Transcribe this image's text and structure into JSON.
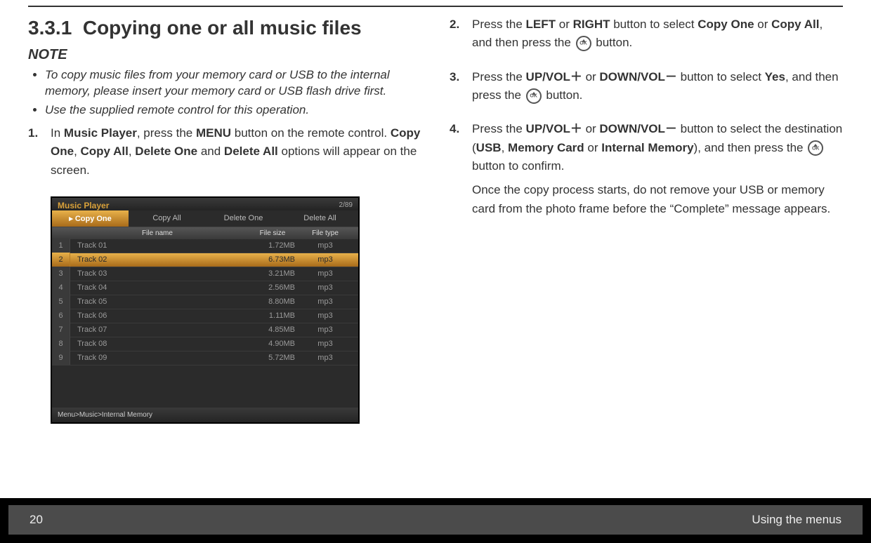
{
  "section": {
    "number": "3.3.1",
    "title": "Copying one or all music files"
  },
  "note": {
    "heading": "NOTE",
    "bullets": [
      "To copy music files from your memory card or USB to the internal memory, please insert your memory card or USB flash drive first.",
      "Use the supplied remote control for this operation."
    ]
  },
  "steps_left": {
    "s1": {
      "num": "1.",
      "pre": "In ",
      "b1": "Music Player",
      "mid1": ", press the ",
      "b2": "MENU",
      "mid2": " button on the remote control. ",
      "b3": "Copy One",
      "sep1": ", ",
      "b4": "Copy All",
      "sep2": ", ",
      "b5": "Delete One",
      "sep3": " and ",
      "b6": "Delete All",
      "tail": " options will appear on the screen."
    }
  },
  "steps_right": {
    "s2": {
      "num": "2.",
      "pre": "Press the ",
      "b1": "LEFT",
      "mid1": " or ",
      "b2": "RIGHT",
      "mid2": " button to select ",
      "b3": "Copy One",
      "mid3": " or ",
      "b4": "Copy All",
      "mid4": ", and then press the ",
      "tail": " button."
    },
    "s3": {
      "num": "3.",
      "pre": "Press the ",
      "b1": "UP/VOL＋",
      "mid1": " or ",
      "b2": "DOWN/VOL－",
      "mid2": " button to select ",
      "b3": "Yes",
      "mid3": ", and then press the ",
      "tail": " button."
    },
    "s4": {
      "num": "4.",
      "pre": "Press the ",
      "b1": "UP/VOL＋",
      "mid1": " or ",
      "b2": "DOWN/VOL－",
      "mid2": " button to select the destination (",
      "b3": "USB",
      "sep1": ", ",
      "b4": "Memory Card",
      "sep2": " or ",
      "b5": "Internal Memory",
      "mid3": "), and then press the ",
      "tail": " button to confirm.",
      "para2": "Once the copy process starts, do not remove your USB or memory card from the photo frame before the “Complete” message appears."
    }
  },
  "device": {
    "title": "Music Player",
    "counter": "2/89",
    "tabs": [
      "Copy One",
      "Copy All",
      "Delete One",
      "Delete All"
    ],
    "active_tab_index": 0,
    "columns": [
      "File name",
      "File size",
      "File type"
    ],
    "rows": [
      {
        "idx": "1",
        "name": "Track 01",
        "size": "1.72MB",
        "type": "mp3"
      },
      {
        "idx": "2",
        "name": "Track 02",
        "size": "6.73MB",
        "type": "mp3"
      },
      {
        "idx": "3",
        "name": "Track 03",
        "size": "3.21MB",
        "type": "mp3"
      },
      {
        "idx": "4",
        "name": "Track 04",
        "size": "2.56MB",
        "type": "mp3"
      },
      {
        "idx": "5",
        "name": "Track 05",
        "size": "8.80MB",
        "type": "mp3"
      },
      {
        "idx": "6",
        "name": "Track 06",
        "size": "1.11MB",
        "type": "mp3"
      },
      {
        "idx": "7",
        "name": "Track 07",
        "size": "4.85MB",
        "type": "mp3"
      },
      {
        "idx": "8",
        "name": "Track 08",
        "size": "4.90MB",
        "type": "mp3"
      },
      {
        "idx": "9",
        "name": "Track 09",
        "size": "5.72MB",
        "type": "mp3"
      }
    ],
    "selected_row_index": 1,
    "breadcrumb": "Menu>Music>Internal Memory"
  },
  "footer": {
    "page": "20",
    "chapter": "Using the menus"
  }
}
